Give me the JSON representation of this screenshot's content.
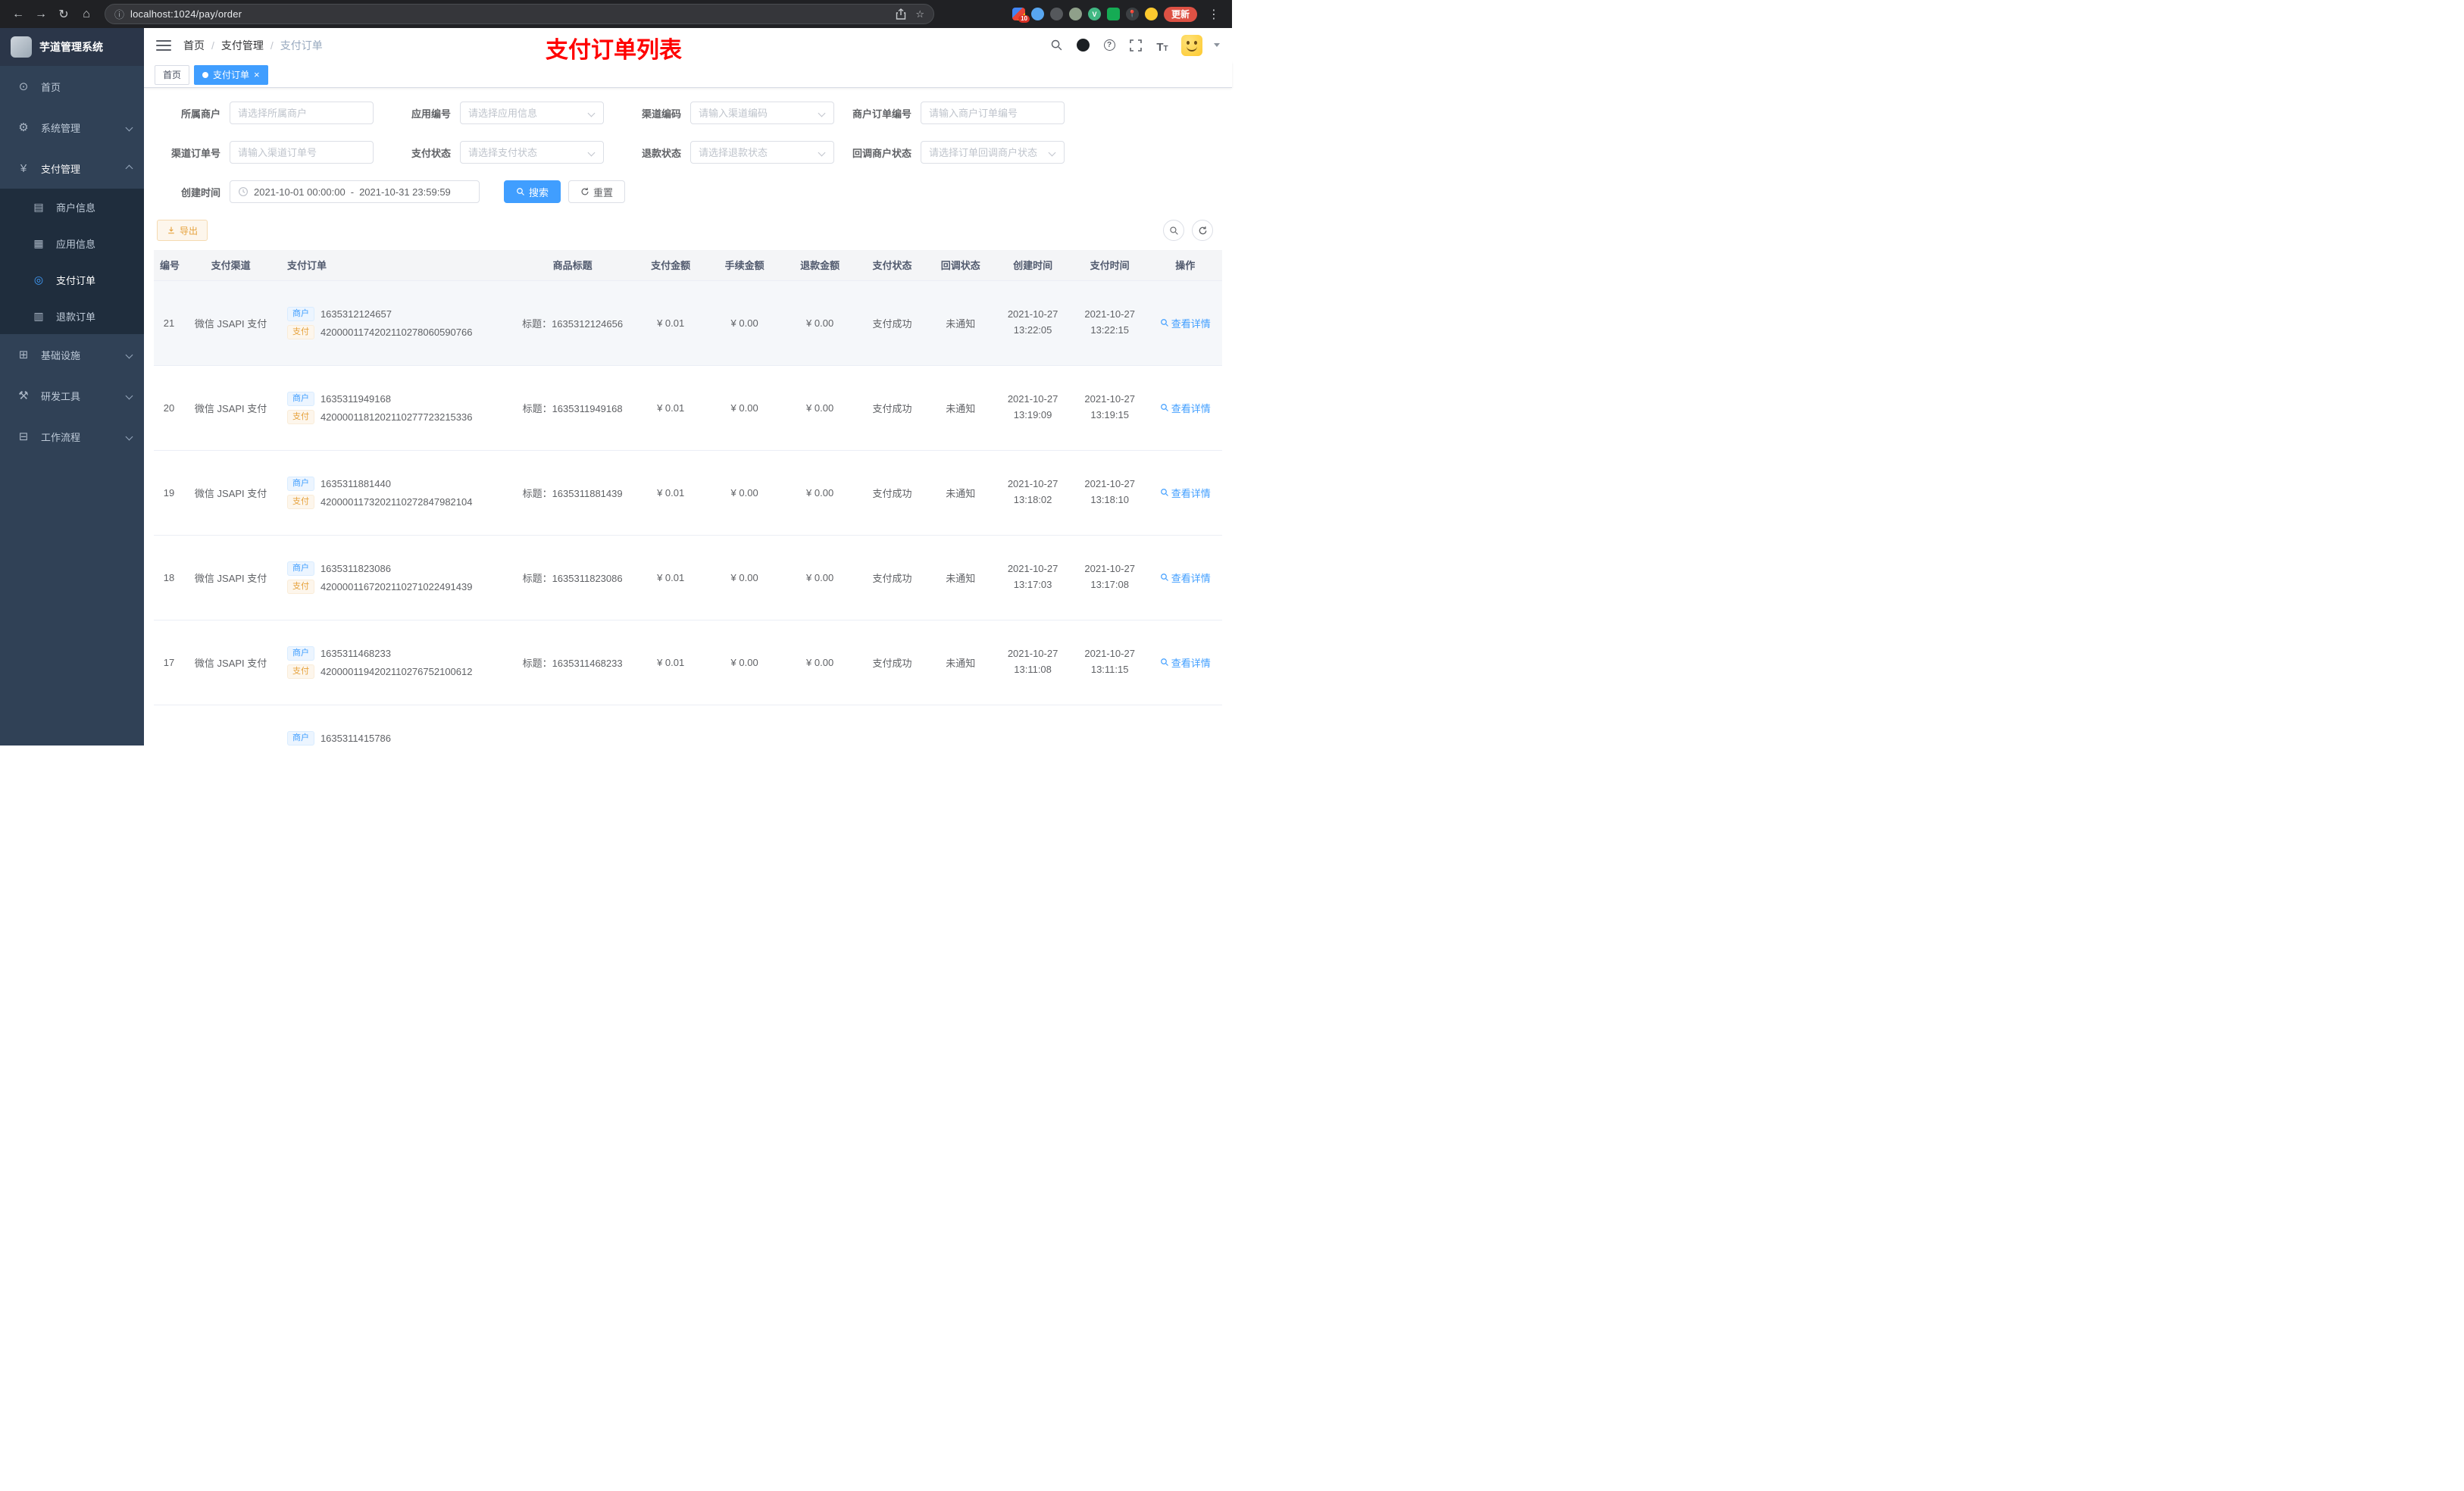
{
  "browser": {
    "url": "localhost:1024/pay/order",
    "update_label": "更新",
    "extension_badge": "10"
  },
  "icons": {
    "back": "←",
    "forward": "→",
    "reload": "↻",
    "browser_home": "⌂",
    "info": "ⓘ",
    "star": "☆",
    "kebab": "⋮",
    "close": "×",
    "menu_home": "⊙",
    "menu_system": "⚙",
    "menu_pay": "¥",
    "menu_merchant": "▤",
    "menu_app": "▦",
    "menu_pay_order": "◎",
    "menu_refund": "▥",
    "menu_infra": "⊞",
    "menu_devtools": "⚒",
    "menu_workflow": "⊟"
  },
  "sidebar": {
    "title": "芋道管理系统",
    "home": "首页",
    "system": "系统管理",
    "pay": "支付管理",
    "merchant_info": "商户信息",
    "app_info": "应用信息",
    "pay_order": "支付订单",
    "refund_order": "退款订单",
    "infra": "基础设施",
    "devtools": "研发工具",
    "workflow": "工作流程"
  },
  "navbar": {
    "breadcrumb_home": "首页",
    "breadcrumb_pay": "支付管理",
    "breadcrumb_order": "支付订单",
    "separator": "/",
    "annotation": "支付订单列表"
  },
  "tabs": {
    "home": "首页",
    "order": "支付订单"
  },
  "filters": {
    "merchant": {
      "label": "所属商户",
      "placeholder": "请选择所属商户"
    },
    "app_no": {
      "label": "应用编号",
      "placeholder": "请选择应用信息"
    },
    "channel_code": {
      "label": "渠道编码",
      "placeholder": "请输入渠道编码"
    },
    "merchant_order_no": {
      "label": "商户订单编号",
      "placeholder": "请输入商户订单编号"
    },
    "channel_order_no": {
      "label": "渠道订单号",
      "placeholder": "请输入渠道订单号"
    },
    "pay_status": {
      "label": "支付状态",
      "placeholder": "请选择支付状态"
    },
    "refund_status": {
      "label": "退款状态",
      "placeholder": "请选择退款状态"
    },
    "notify_status": {
      "label": "回调商户状态",
      "placeholder": "请选择订单回调商户状态"
    },
    "create_time": {
      "label": "创建时间",
      "start": "2021-10-01 00:00:00",
      "separator": "-",
      "end": "2021-10-31 23:59:59"
    },
    "search_label": "搜索",
    "reset_label": "重置"
  },
  "toolbar": {
    "export_label": "导出"
  },
  "table": {
    "merchant_tag": "商户",
    "pay_tag": "支付",
    "headers": {
      "id": "编号",
      "channel": "支付渠道",
      "order": "支付订单",
      "title": "商品标题",
      "amount": "支付金额",
      "fee": "手续金额",
      "refund": "退款金额",
      "status": "支付状态",
      "notify": "回调状态",
      "create": "创建时间",
      "pay": "支付时间",
      "action": "操作"
    },
    "rows": [
      {
        "id": "21",
        "channel": "微信 JSAPI 支付",
        "merchant_no": "1635312124657",
        "pay_no": "4200001174202110278060590766",
        "title": "标题：1635312124656",
        "amount": "¥ 0.01",
        "fee": "¥ 0.00",
        "refund": "¥ 0.00",
        "status": "支付成功",
        "notify": "未通知",
        "create_date": "2021-10-27",
        "create_clock": "13:22:05",
        "pay_date": "2021-10-27",
        "pay_clock": "13:22:15",
        "action": "查看详情"
      },
      {
        "id": "20",
        "channel": "微信 JSAPI 支付",
        "merchant_no": "1635311949168",
        "pay_no": "4200001181202110277723215336",
        "title": "标题：1635311949168",
        "amount": "¥ 0.01",
        "fee": "¥ 0.00",
        "refund": "¥ 0.00",
        "status": "支付成功",
        "notify": "未通知",
        "create_date": "2021-10-27",
        "create_clock": "13:19:09",
        "pay_date": "2021-10-27",
        "pay_clock": "13:19:15",
        "action": "查看详情"
      },
      {
        "id": "19",
        "channel": "微信 JSAPI 支付",
        "merchant_no": "1635311881440",
        "pay_no": "4200001173202110272847982104",
        "title": "标题：1635311881439",
        "amount": "¥ 0.01",
        "fee": "¥ 0.00",
        "refund": "¥ 0.00",
        "status": "支付成功",
        "notify": "未通知",
        "create_date": "2021-10-27",
        "create_clock": "13:18:02",
        "pay_date": "2021-10-27",
        "pay_clock": "13:18:10",
        "action": "查看详情"
      },
      {
        "id": "18",
        "channel": "微信 JSAPI 支付",
        "merchant_no": "1635311823086",
        "pay_no": "4200001167202110271022491439",
        "title": "标题：1635311823086",
        "amount": "¥ 0.01",
        "fee": "¥ 0.00",
        "refund": "¥ 0.00",
        "status": "支付成功",
        "notify": "未通知",
        "create_date": "2021-10-27",
        "create_clock": "13:17:03",
        "pay_date": "2021-10-27",
        "pay_clock": "13:17:08",
        "action": "查看详情"
      },
      {
        "id": "17",
        "channel": "微信 JSAPI 支付",
        "merchant_no": "1635311468233",
        "pay_no": "4200001194202110276752100612",
        "title": "标题：1635311468233",
        "amount": "¥ 0.01",
        "fee": "¥ 0.00",
        "refund": "¥ 0.00",
        "status": "支付成功",
        "notify": "未通知",
        "create_date": "2021-10-27",
        "create_clock": "13:11:08",
        "pay_date": "2021-10-27",
        "pay_clock": "13:11:15",
        "action": "查看详情"
      },
      {
        "id": "",
        "channel": "",
        "merchant_no": "1635311415786",
        "pay_no": "",
        "title": "",
        "amount": "",
        "fee": "",
        "refund": "",
        "status": "",
        "notify": "",
        "create_date": "",
        "create_clock": "",
        "pay_date": "",
        "pay_clock": "",
        "action": ""
      }
    ]
  }
}
